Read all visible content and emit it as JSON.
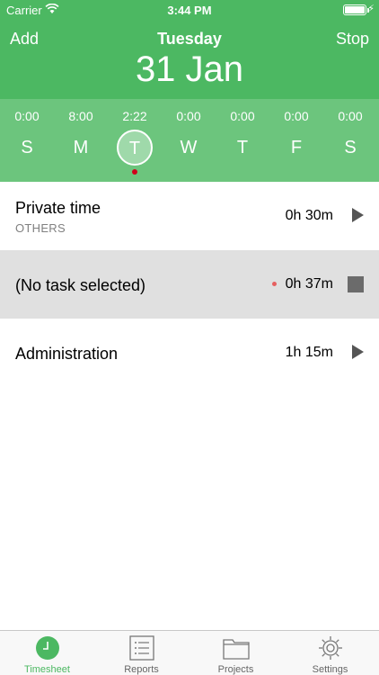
{
  "status_bar": {
    "carrier": "Carrier",
    "time": "3:44 PM",
    "charging": "⚡"
  },
  "nav": {
    "add_label": "Add",
    "stop_label": "Stop",
    "day_name": "Tuesday",
    "date": "31 Jan"
  },
  "week": {
    "days": [
      {
        "time": "0:00",
        "letter": "S",
        "selected": false
      },
      {
        "time": "8:00",
        "letter": "M",
        "selected": false
      },
      {
        "time": "2:22",
        "letter": "T",
        "selected": true
      },
      {
        "time": "0:00",
        "letter": "W",
        "selected": false
      },
      {
        "time": "0:00",
        "letter": "T",
        "selected": false
      },
      {
        "time": "0:00",
        "letter": "F",
        "selected": false
      },
      {
        "time": "0:00",
        "letter": "S",
        "selected": false
      }
    ]
  },
  "entries": [
    {
      "title": "Private time",
      "subtitle": "OTHERS",
      "duration": "0h 30m",
      "state": "paused"
    },
    {
      "title": "(No task selected)",
      "duration": "0h 37m",
      "state": "running"
    },
    {
      "title": "Administration",
      "duration": "1h 15m",
      "state": "paused"
    }
  ],
  "tabs": [
    {
      "label": "Timesheet",
      "icon": "clock-icon",
      "active": true
    },
    {
      "label": "Reports",
      "icon": "list-icon",
      "active": false
    },
    {
      "label": "Projects",
      "icon": "folder-icon",
      "active": false
    },
    {
      "label": "Settings",
      "icon": "gear-icon",
      "active": false
    }
  ],
  "colors": {
    "header": "#4cb862",
    "week_strip": "#6cc57d",
    "accent": "#4cb862",
    "running_row": "#e0e0e0"
  }
}
